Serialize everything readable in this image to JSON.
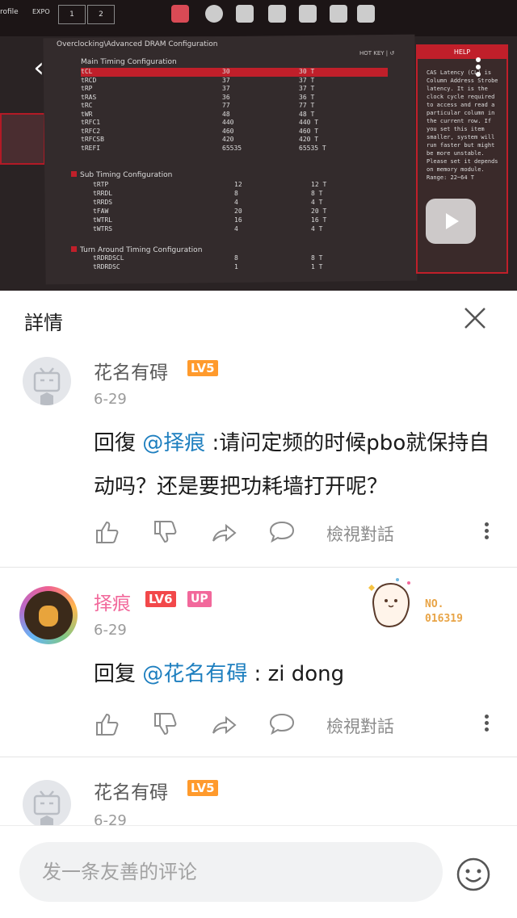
{
  "video": {
    "breadcrumb": "Overclocking\\Advanced DRAM Configuration",
    "hotkey": "HOT KEY | ↺",
    "help_title": "HELP",
    "help_text": "CAS Latency (CL) is Column Address Strobe latency. It is the clock cycle required to access and read a particular column in the current row. If you set this item smaller, system will run faster but might be more unstable. Please set it depends on memory module. Range: 22~64 T",
    "main_section": "Main Timing Configuration",
    "main_rows": [
      {
        "name": "tCL",
        "value": "30",
        "timing": "30 T"
      },
      {
        "name": "tRCD",
        "value": "37",
        "timing": "37 T"
      },
      {
        "name": "tRP",
        "value": "37",
        "timing": "37 T"
      },
      {
        "name": "tRAS",
        "value": "36",
        "timing": "36 T"
      },
      {
        "name": "tRC",
        "value": "77",
        "timing": "77 T"
      },
      {
        "name": "tWR",
        "value": "48",
        "timing": "48 T"
      },
      {
        "name": "tRFC1",
        "value": "440",
        "timing": "440 T"
      },
      {
        "name": "tRFC2",
        "value": "460",
        "timing": "460 T"
      },
      {
        "name": "tRFCSB",
        "value": "420",
        "timing": "420 T"
      },
      {
        "name": "tREFI",
        "value": "65535",
        "timing": "65535 T"
      }
    ],
    "sub_section": "Sub Timing Configuration",
    "sub_rows": [
      {
        "name": "tRTP",
        "value": "12",
        "timing": "12 T"
      },
      {
        "name": "tRRDL",
        "value": "8",
        "timing": "8 T"
      },
      {
        "name": "tRRDS",
        "value": "4",
        "timing": "4 T"
      },
      {
        "name": "tFAW",
        "value": "20",
        "timing": "20 T"
      },
      {
        "name": "tWTRL",
        "value": "16",
        "timing": "16 T"
      },
      {
        "name": "tWTRS",
        "value": "4",
        "timing": "4 T"
      }
    ],
    "turn_section": "Turn Around Timing Configuration",
    "turn_rows": [
      {
        "name": "tRDRDSCL",
        "value": "8",
        "timing": "8 T"
      },
      {
        "name": "tRDRDSC",
        "value": "1",
        "timing": "1 T"
      }
    ],
    "top_labels": [
      "rofile",
      "EXPO",
      "1",
      "2"
    ]
  },
  "header": {
    "title": "詳情"
  },
  "comments": [
    {
      "user": "花名有碍",
      "level": "LV5",
      "date": "6-29",
      "reply_prefix": "回復 ",
      "mention": "@择痕",
      "text": " :请问定频的时候pbo就保持自动吗？还是要把功耗墙打开呢？",
      "view_convo": "檢視對話"
    },
    {
      "user": "择痕",
      "level": "LV6",
      "up": "UP",
      "date": "6-29",
      "reply_prefix": "回复 ",
      "mention": "@花名有碍",
      "text": " : zi dong",
      "view_convo": "檢視對話",
      "fan_badge": {
        "line1": "NO.",
        "line2": "016319"
      }
    },
    {
      "user": "花名有碍",
      "level": "LV5",
      "date": "6-29"
    }
  ],
  "input": {
    "placeholder": "发一条友善的评论"
  },
  "colors": {
    "accent": "#f2689b",
    "mention": "#1e7fbf",
    "lv5": "#ff9a2c",
    "lv6": "#f2484a"
  }
}
